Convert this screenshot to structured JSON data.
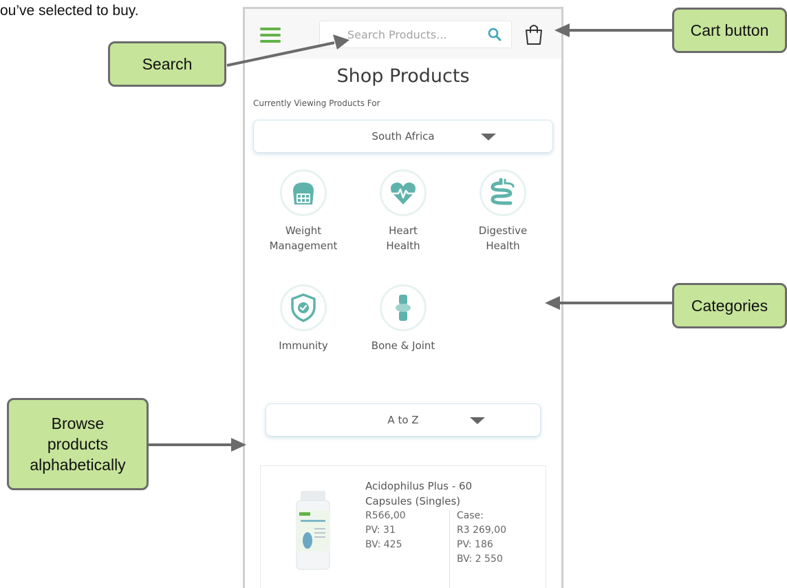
{
  "intro_text": "ou’ve selected to buy.",
  "header": {
    "search_placeholder": "Search Products..."
  },
  "page_title": "Shop Products",
  "viewing_label": "Currently Viewing Products For",
  "country_select": {
    "value": "South Africa"
  },
  "categories": [
    {
      "label_line1": "Weight",
      "label_line2": "Management",
      "icon": "weight-management-icon"
    },
    {
      "label_line1": "Heart",
      "label_line2": "Health",
      "icon": "heart-health-icon"
    },
    {
      "label_line1": "Digestive",
      "label_line2": "Health",
      "icon": "digestive-health-icon"
    },
    {
      "label_line1": "Immunity",
      "label_line2": "",
      "icon": "immunity-shield-icon"
    },
    {
      "label_line1": "Bone & Joint",
      "label_line2": "",
      "icon": "bone-joint-icon"
    }
  ],
  "sort_select": {
    "value": "A to Z"
  },
  "product": {
    "name_line1": "Acidophilus Plus - 60",
    "name_line2": "Capsules (Singles)",
    "single_price": "R566,00",
    "single_pv": "PV: 31",
    "single_bv": "BV: 425",
    "case_label": "Case:",
    "case_price": "R3 269,00",
    "case_pv": "PV: 186",
    "case_bv": "BV: 2 550"
  },
  "callouts": {
    "search": "Search",
    "cart": "Cart button",
    "categories": "Categories",
    "browse_line1": "Browse",
    "browse_line2": "products",
    "browse_line3": "alphabetically"
  },
  "colors": {
    "accent_green": "#63b249",
    "callout_fill": "#c6e49a",
    "teal_icon": "#5fb3ab"
  }
}
